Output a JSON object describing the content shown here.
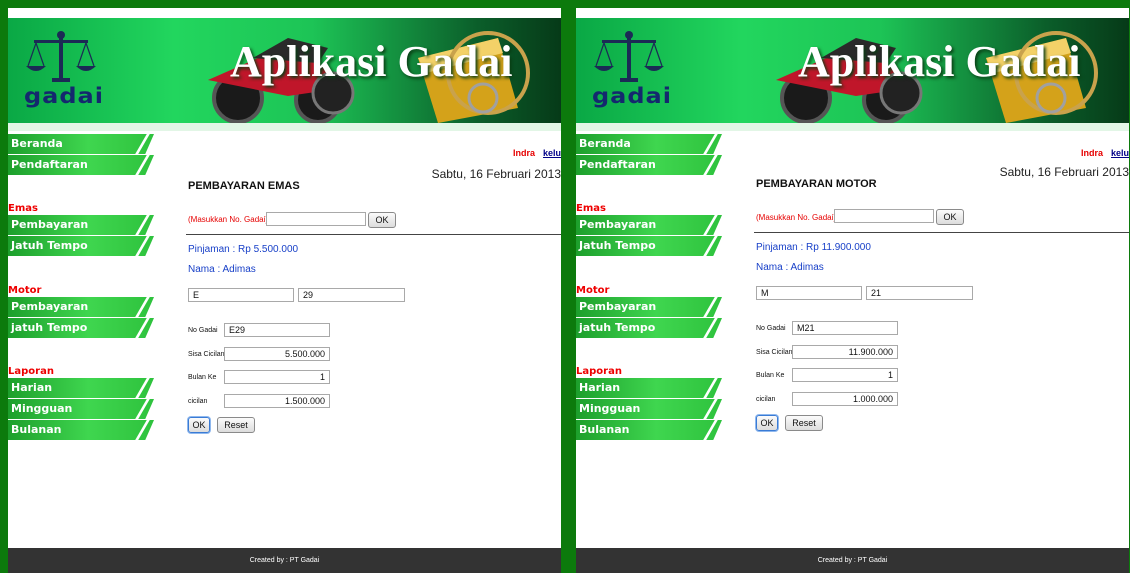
{
  "app": {
    "banner_title": "Aplikasi Gadai",
    "logo_text": "gadai",
    "footer": "Created by : PT Gadai"
  },
  "nav": {
    "beranda": "Beranda",
    "pendaftaran": "Pendaftaran",
    "emas_heading": "Emas",
    "emas_pembayaran": "Pembayaran",
    "emas_jatuh_tempo": "Jatuh Tempo",
    "motor_heading": "Motor",
    "motor_pembayaran": "Pembayaran",
    "motor_jatuh_tempo": "jatuh Tempo",
    "laporan_heading": "Laporan",
    "harian": "Harian",
    "mingguan": "Mingguan",
    "bulanan": "Bulanan"
  },
  "left": {
    "user": "Indra",
    "logout": "keluar",
    "date": "Sabtu, 16 Februari 2013",
    "title": "PEMBAYARAN EMAS",
    "search_label": "(Masukkan No. Gadai)",
    "search_value": "",
    "search_button": "OK",
    "pinjaman": "Pinjaman : Rp 5.500.000",
    "nama": "Nama : Adimas",
    "code_prefix": "E",
    "code_number": "29",
    "form": {
      "no_gadai_label": "No Gadai",
      "no_gadai_value": "E29",
      "sisa_label": "Sisa Cicilan",
      "sisa_value": "5.500.000",
      "bulan_label": "Bulan Ke",
      "bulan_value": "1",
      "cicilan_label": "cicilan",
      "cicilan_value": "1.500.000",
      "ok_button": "OK",
      "reset_button": "Reset"
    }
  },
  "right": {
    "user": "Indra",
    "logout": "keluar",
    "date": "Sabtu, 16 Februari 2013",
    "title": "PEMBAYARAN MOTOR",
    "search_label": "(Masukkan No. Gadai)",
    "search_value": "",
    "search_button": "OK",
    "pinjaman": "Pinjaman : Rp 11.900.000",
    "nama": "Nama : Adimas",
    "code_prefix": "M",
    "code_number": "21",
    "form": {
      "no_gadai_label": "No Gadai",
      "no_gadai_value": "M21",
      "sisa_label": "Sisa Cicilan",
      "sisa_value": "11.900.000",
      "bulan_label": "Bulan Ke",
      "bulan_value": "1",
      "cicilan_label": "cicilan",
      "cicilan_value": "1.000.000",
      "ok_button": "OK",
      "reset_button": "Reset"
    }
  }
}
